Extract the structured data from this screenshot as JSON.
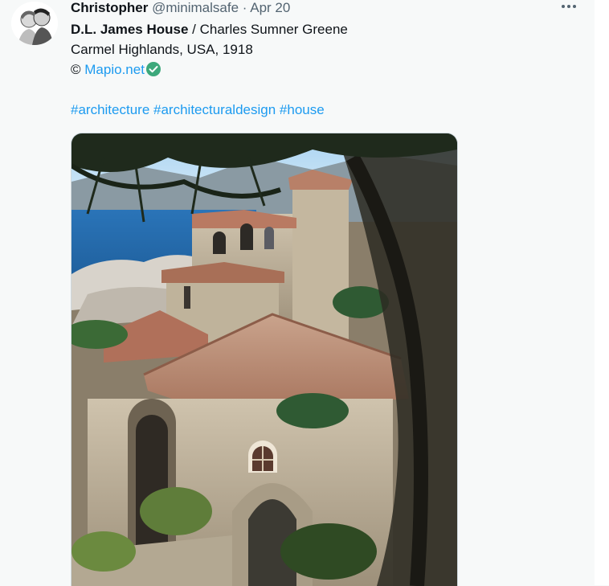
{
  "tweet": {
    "author_name": "Christopher",
    "handle": "@minimalsafe",
    "separator": "·",
    "date": "Apr 20",
    "more_icon": "more-horizontal-icon",
    "title_bold": "D.L. James House",
    "title_rest": " / Charles Sumner Greene",
    "location": "Carmel Highlands, USA, 1918",
    "credit_symbol": "©",
    "credit_link": "Mapio.net",
    "verified_icon": "check-circle-icon",
    "hashtags": [
      "#architecture",
      "#architecturaldesign",
      "#house"
    ]
  },
  "colors": {
    "link": "#1d9bf0",
    "muted": "#536471",
    "text": "#0f1419",
    "verified": "#3ca87b"
  }
}
